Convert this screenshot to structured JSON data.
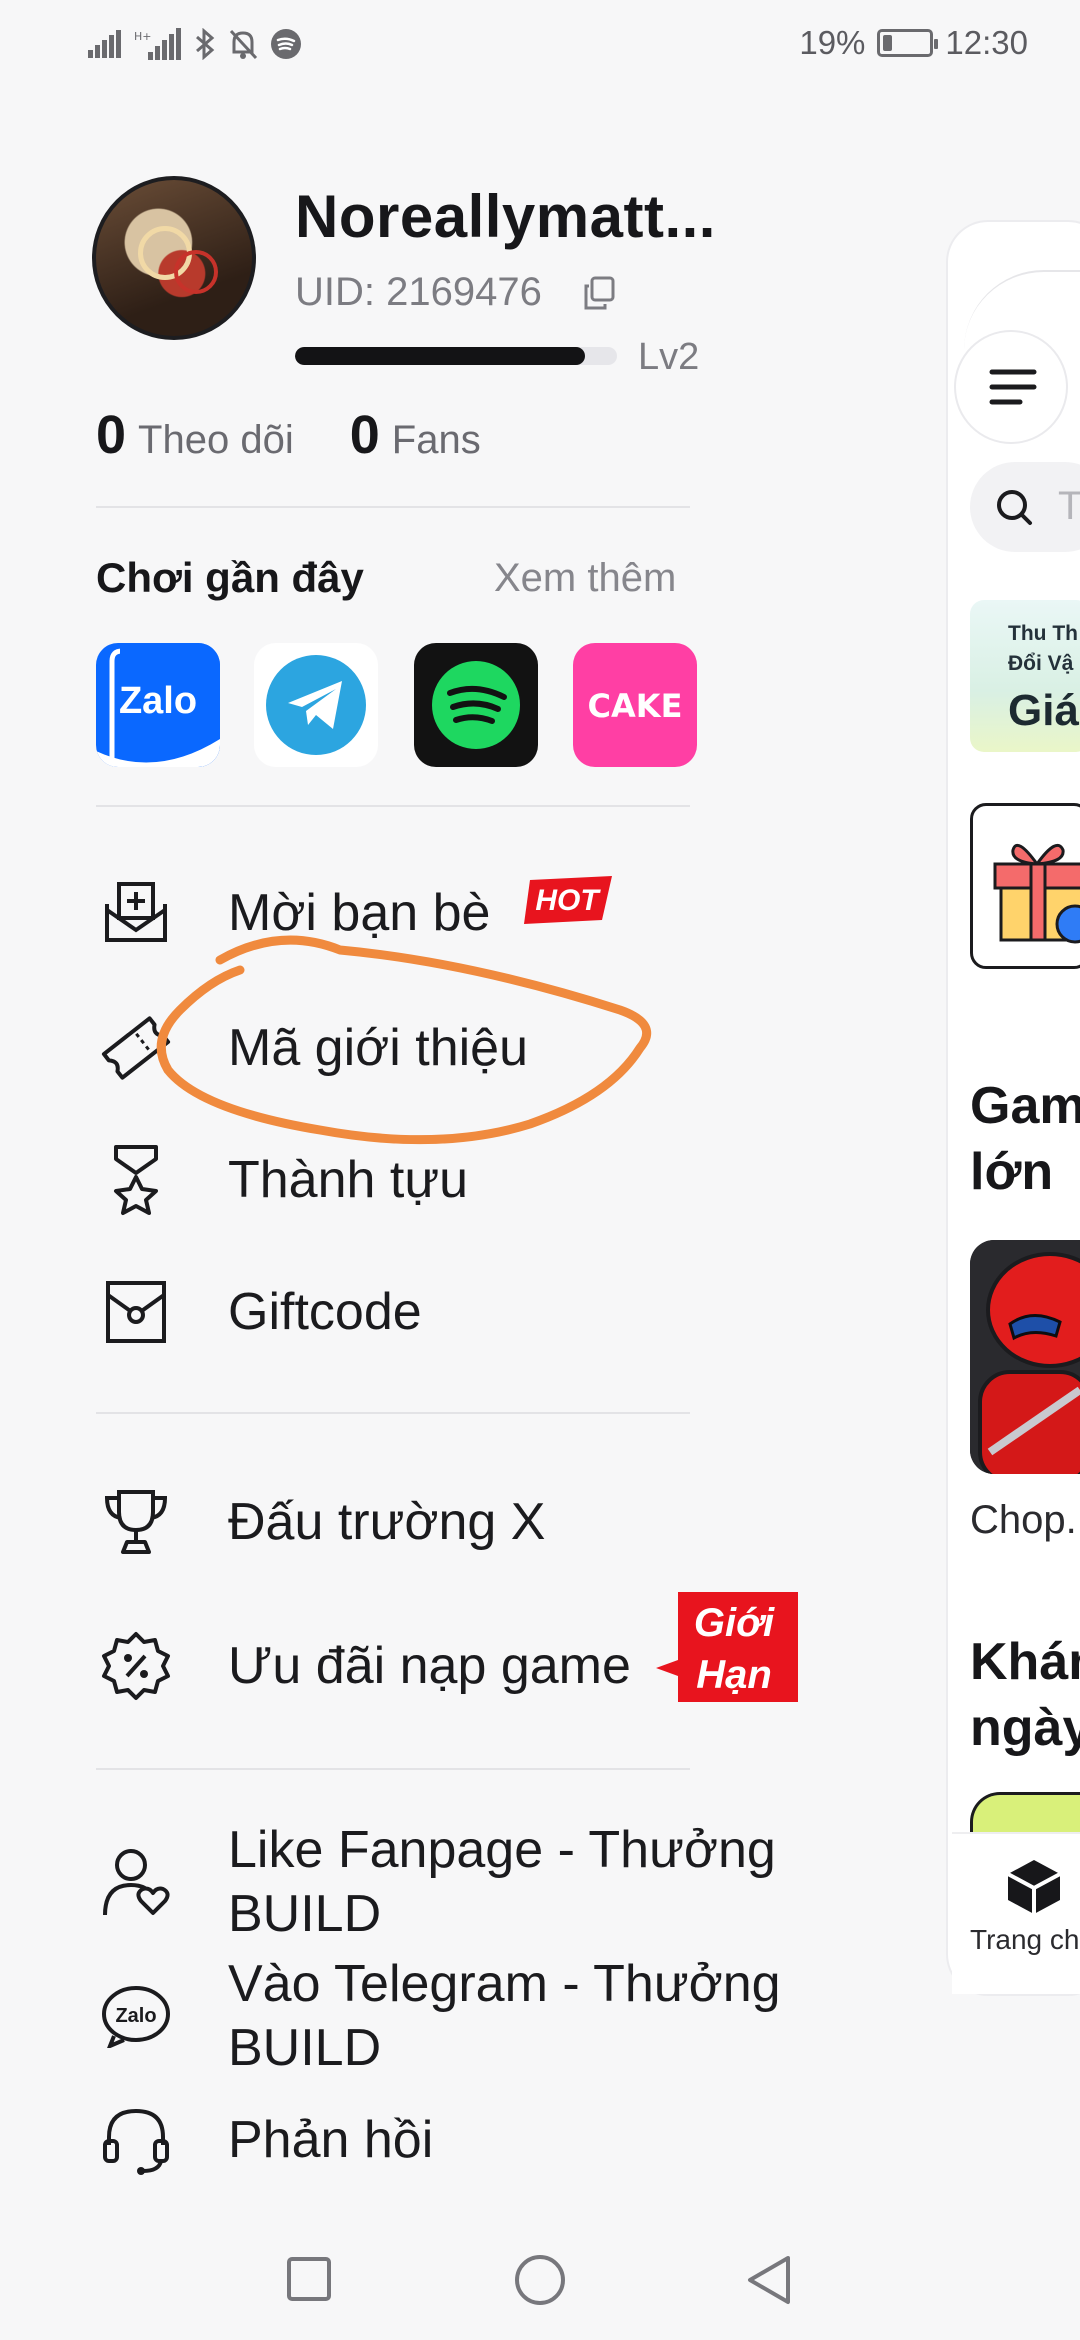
{
  "status_bar": {
    "battery_percent": "19%",
    "battery_level": 0.19,
    "time": "12:30",
    "icons": [
      "signal-icon",
      "signal-2-icon",
      "bluetooth-icon",
      "mute-icon",
      "spotify-icon"
    ]
  },
  "profile": {
    "username": "Noreallymatt...",
    "uid": "UID: 2169476",
    "level": "Lv2",
    "level_progress": 0.9,
    "following_count": "0",
    "following_label": "Theo dõi",
    "fans_count": "0",
    "fans_label": "Fans"
  },
  "recent": {
    "title": "Chơi gần đây",
    "see_more": "Xem thêm",
    "apps": [
      {
        "name": "Zalo",
        "color": "#0a68ff"
      },
      {
        "name": "Telegram",
        "color": "#2ca5e0"
      },
      {
        "name": "Spotify",
        "color": "#1ed760"
      },
      {
        "name": "CAKE",
        "color": "#ff3fa4"
      }
    ]
  },
  "menu": {
    "group1": [
      {
        "label": "Mời bạn bè",
        "icon": "invite-mail-icon"
      },
      {
        "label": "Mã giới thiệu",
        "icon": "ticket-icon"
      },
      {
        "label": "Thành tựu",
        "icon": "medal-icon"
      },
      {
        "label": "Giftcode",
        "icon": "gift-envelope-icon"
      }
    ],
    "group2": [
      {
        "label": "Đấu trường X",
        "icon": "trophy-icon"
      },
      {
        "label": "Ưu đãi nạp game",
        "icon": "discount-badge-icon"
      }
    ],
    "group3": [
      {
        "label": "Like Fanpage - Thưởng BUILD",
        "icon": "user-heart-icon"
      },
      {
        "label": "Vào Telegram - Thưởng BUILD",
        "icon": "zalo-icon"
      },
      {
        "label": "Phản hồi",
        "icon": "headset-icon"
      }
    ],
    "hot_badge": "HOT",
    "limit_badge_line1": "Giới",
    "limit_badge_line2": "Hạn"
  },
  "peek": {
    "banner_line1": "Thu Th",
    "banner_line2": "Đổi Vậ",
    "banner_line3": "Giá",
    "heading1_line1": "Gam",
    "heading1_line2": "lớn",
    "game_label": "Chop.",
    "heading2_line1": "Khán",
    "heading2_line2": "ngày",
    "home_label": "Trang ch",
    "search_letter": "T"
  },
  "colors": {
    "annotation": "#f08a3e",
    "hot_red": "#e8141e",
    "accent_dark": "#131315"
  }
}
